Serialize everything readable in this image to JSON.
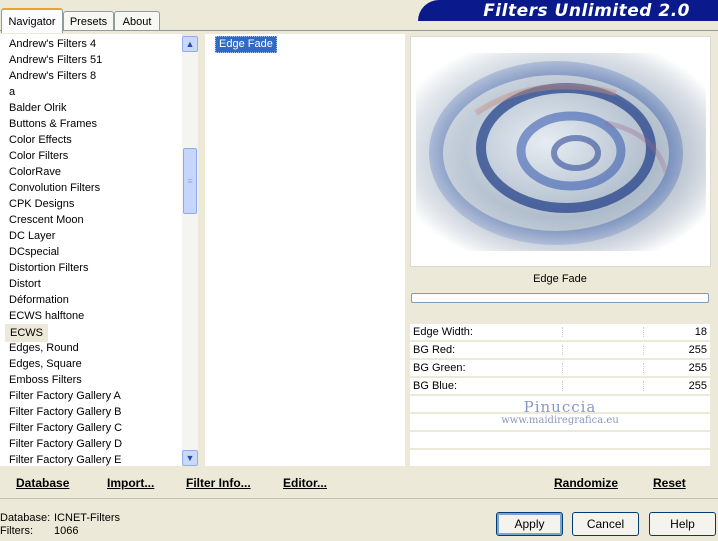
{
  "tabs": [
    {
      "label": "Navigator",
      "active": true
    },
    {
      "label": "Presets",
      "active": false
    },
    {
      "label": "About",
      "active": false
    }
  ],
  "title": "Filters Unlimited 2.0",
  "categories": [
    "Andrew's Filters 4",
    "Andrew's Filters 51",
    "Andrew's Filters 8",
    "a",
    "Balder Olrik",
    "Buttons & Frames",
    "Color Effects",
    "Color Filters",
    "ColorRave",
    "Convolution Filters",
    "CPK Designs",
    "Crescent Moon",
    "DC Layer",
    "DCspecial",
    "Distortion Filters",
    "Distort",
    "Déformation",
    "ECWS halftone",
    "ECWS",
    "Edges, Round",
    "Edges, Square",
    "Emboss Filters",
    "Filter Factory Gallery A",
    "Filter Factory Gallery B",
    "Filter Factory Gallery C",
    "Filter Factory Gallery D",
    "Filter Factory Gallery E"
  ],
  "selected_category": "ECWS",
  "filters": [
    "Edge Fade"
  ],
  "selected_filter": "Edge Fade",
  "preview_filter_name": "Edge Fade",
  "params": [
    {
      "label": "Edge Width:",
      "value": "18"
    },
    {
      "label": "BG Red:",
      "value": "255"
    },
    {
      "label": "BG Green:",
      "value": "255"
    },
    {
      "label": "BG Blue:",
      "value": "255"
    }
  ],
  "watermark": {
    "name": "Pinuccia",
    "url": "www.maidiregrafica.eu"
  },
  "links": {
    "database": "Database",
    "import": "Import...",
    "filter_info": "Filter Info...",
    "editor": "Editor...",
    "randomize": "Randomize",
    "reset": "Reset"
  },
  "db_info": {
    "database_key": "Database:",
    "database_value": "ICNET-Filters",
    "filters_key": "Filters:",
    "filters_value": "1066"
  },
  "buttons": {
    "apply": "Apply",
    "cancel": "Cancel",
    "help": "Help"
  },
  "colors": {
    "banner": "#0a1a8c",
    "selection": "#316ac5",
    "background": "#ece9d8"
  }
}
